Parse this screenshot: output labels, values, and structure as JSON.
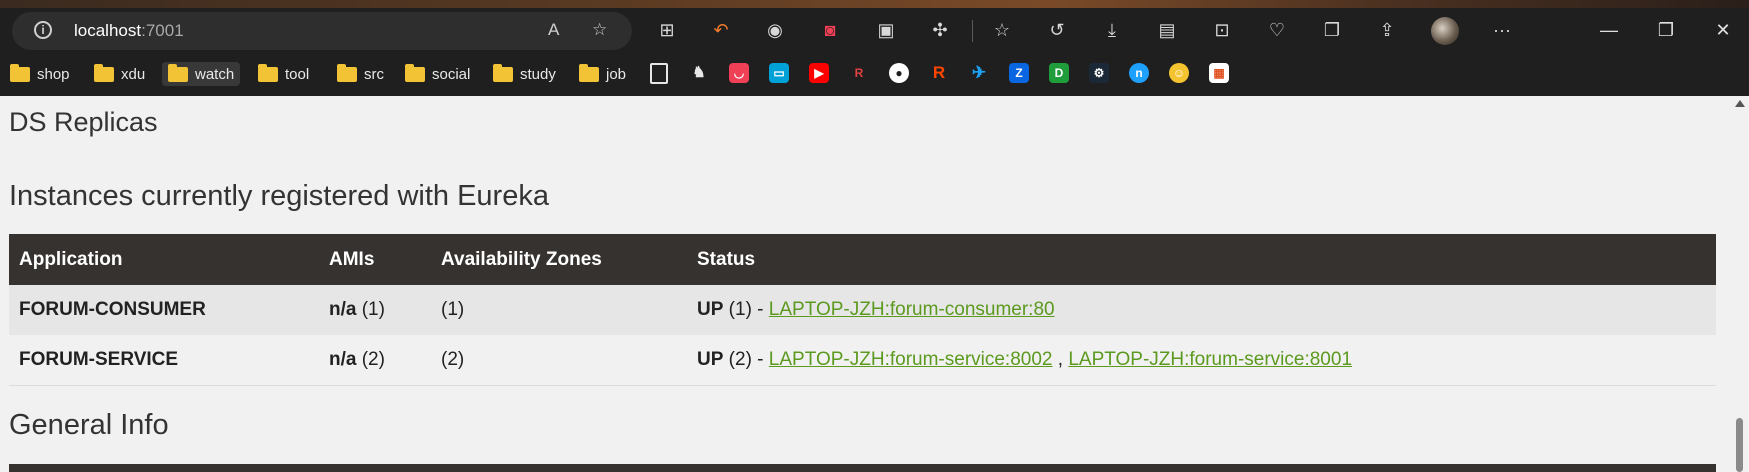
{
  "browser": {
    "url_host": "localhost",
    "url_port": ":7001",
    "bookmarks": [
      "shop",
      "xdu",
      "watch",
      "tool",
      "src",
      "social",
      "study",
      "job"
    ],
    "window_controls": [
      "minimize",
      "restore",
      "close"
    ],
    "more_label": "···"
  },
  "page": {
    "ds_replicas_title": "DS Replicas",
    "instances_title": "Instances currently registered with Eureka",
    "general_info_title": "General Info",
    "table": {
      "headers": [
        "Application",
        "AMIs",
        "Availability Zones",
        "Status"
      ],
      "rows": [
        {
          "application": "FORUM-CONSUMER",
          "ami_bold": "n/a",
          "ami_count": " (1)",
          "zones": "(1)",
          "status_bold": "UP",
          "status_count": " (1) - ",
          "link1": "LAPTOP-JZH:forum-consumer:80",
          "sep": "",
          "link2": ""
        },
        {
          "application": "FORUM-SERVICE",
          "ami_bold": "n/a",
          "ami_count": " (2)",
          "zones": "(2)",
          "status_bold": "UP",
          "status_count": " (2) - ",
          "link1": "LAPTOP-JZH:forum-service:8002",
          "sep": " , ",
          "link2": "LAPTOP-JZH:forum-service:8001"
        }
      ]
    }
  },
  "colors": {
    "header_bg": "#363230",
    "link": "#5c9a1f",
    "row_alt": "#e6e6e6"
  }
}
